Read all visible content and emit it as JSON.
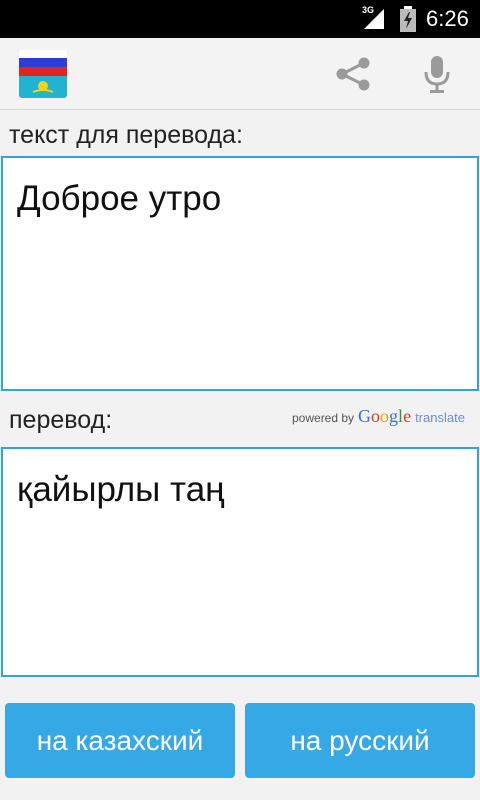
{
  "status_bar": {
    "network": "3G",
    "time": "6:26"
  },
  "action_bar": {
    "icons": [
      "flag-ru-kz-icon",
      "share-icon",
      "microphone-icon"
    ]
  },
  "source": {
    "label": "текст для перевода:",
    "text": "Доброе утро"
  },
  "target": {
    "label": "перевод:",
    "text": "қайырлы таң"
  },
  "attribution": {
    "powered_by": "powered by",
    "google": "Google",
    "translate": "translate"
  },
  "buttons": {
    "to_kazakh": "на казахский",
    "to_russian": "на русский"
  },
  "colors": {
    "accent": "#35a9e5",
    "border": "#33a3e0"
  }
}
